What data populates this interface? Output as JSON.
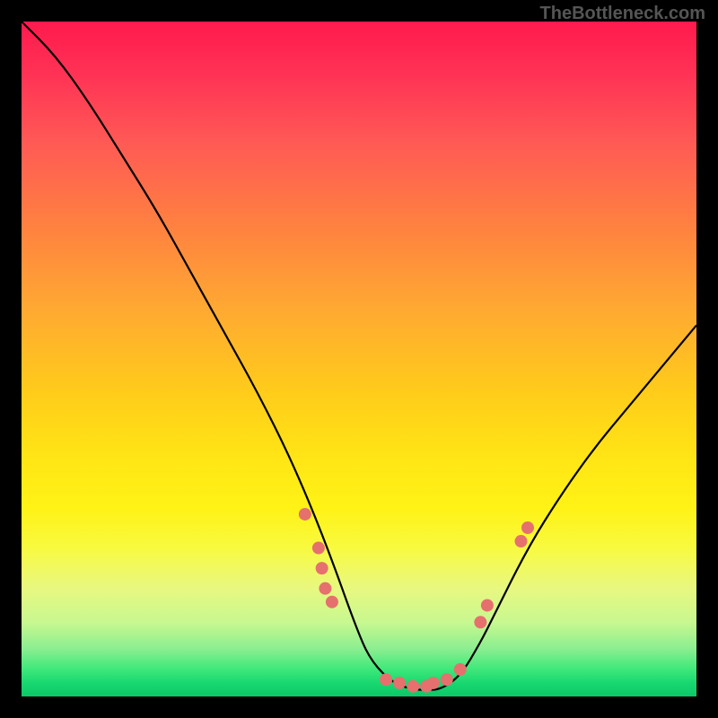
{
  "watermark": "TheBottleneck.com",
  "chart_data": {
    "type": "line",
    "title": "",
    "xlabel": "",
    "ylabel": "",
    "xlim": [
      0,
      100
    ],
    "ylim": [
      0,
      100
    ],
    "series": [
      {
        "name": "curve",
        "x": [
          0,
          5,
          10,
          15,
          20,
          25,
          30,
          35,
          40,
          45,
          50,
          52,
          55,
          58,
          60,
          62,
          65,
          68,
          70,
          75,
          80,
          85,
          90,
          95,
          100
        ],
        "y": [
          100,
          95,
          88,
          80,
          72,
          63,
          54,
          45,
          35,
          23,
          9,
          5,
          2,
          1,
          1,
          1,
          3,
          8,
          12,
          22,
          30,
          37,
          43,
          49,
          55
        ]
      }
    ],
    "scatter": [
      {
        "name": "dots",
        "points": [
          {
            "x": 42,
            "y": 27
          },
          {
            "x": 44,
            "y": 22
          },
          {
            "x": 44.5,
            "y": 19
          },
          {
            "x": 45,
            "y": 16
          },
          {
            "x": 46,
            "y": 14
          },
          {
            "x": 54,
            "y": 2.5
          },
          {
            "x": 56,
            "y": 2
          },
          {
            "x": 58,
            "y": 1.5
          },
          {
            "x": 60,
            "y": 1.5
          },
          {
            "x": 61,
            "y": 2
          },
          {
            "x": 63,
            "y": 2.5
          },
          {
            "x": 65,
            "y": 4
          },
          {
            "x": 68,
            "y": 11
          },
          {
            "x": 69,
            "y": 13.5
          },
          {
            "x": 74,
            "y": 23
          },
          {
            "x": 75,
            "y": 25
          }
        ]
      }
    ],
    "background_gradient": {
      "top": "#ff1a4d",
      "mid": "#ffd500",
      "bottom": "#0cc868"
    }
  }
}
